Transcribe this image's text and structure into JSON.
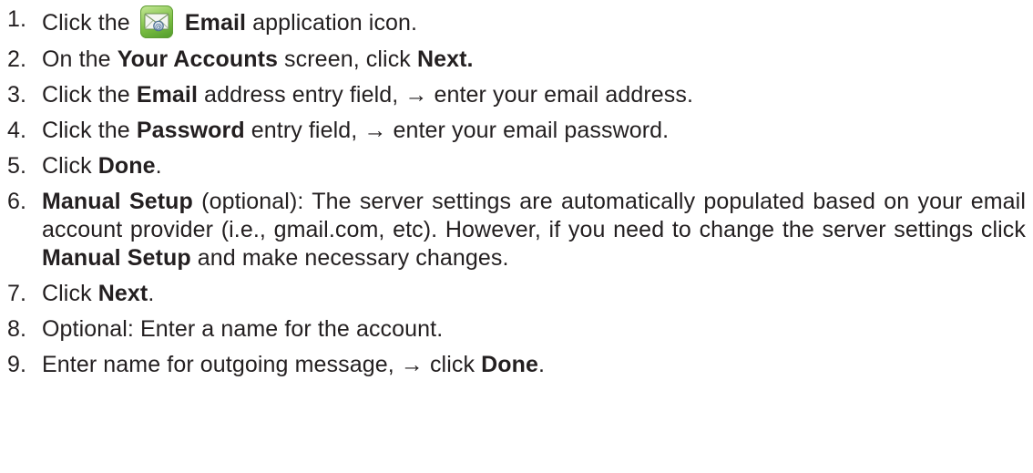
{
  "steps": [
    {
      "num": "1.",
      "parts": [
        {
          "t": "Click the "
        },
        {
          "icon": "email-app-icon"
        },
        {
          "t": " Email",
          "b": true
        },
        {
          "t": " application icon."
        }
      ]
    },
    {
      "num": "2.",
      "parts": [
        {
          "t": "On the "
        },
        {
          "t": "Your Accounts",
          "b": true
        },
        {
          "t": " screen, click "
        },
        {
          "t": "Next.",
          "b": true
        }
      ]
    },
    {
      "num": "3.",
      "parts": [
        {
          "t": "Click the "
        },
        {
          "t": "Email",
          "b": true
        },
        {
          "t": " address entry field, → enter your email address."
        }
      ]
    },
    {
      "num": "4.",
      "parts": [
        {
          "t": "Click the "
        },
        {
          "t": "Password",
          "b": true
        },
        {
          "t": " entry field, → enter your email password."
        }
      ]
    },
    {
      "num": "5.",
      "parts": [
        {
          "t": "Click "
        },
        {
          "t": "Done",
          "b": true
        },
        {
          "t": "."
        }
      ]
    },
    {
      "num": "6.",
      "justify": true,
      "parts": [
        {
          "t": "Manual Setup",
          "b": true
        },
        {
          "t": " (optional): The server settings are automatically populated based on your email account provider (i.e., gmail.com, etc). However, if you need to change the server settings click "
        },
        {
          "t": "Manual Setup",
          "b": true
        },
        {
          "t": " and make necessary changes."
        }
      ]
    },
    {
      "num": "7.",
      "parts": [
        {
          "t": "Click "
        },
        {
          "t": "Next",
          "b": true
        },
        {
          "t": "."
        }
      ]
    },
    {
      "num": "8.",
      "parts": [
        {
          "t": "Optional: Enter a name for the account."
        }
      ]
    },
    {
      "num": "9.",
      "parts": [
        {
          "t": "Enter name for outgoing message, → click "
        },
        {
          "t": "Done",
          "b": true
        },
        {
          "t": "."
        }
      ]
    }
  ],
  "colors": {
    "text": "#231f20",
    "icon_green": "#7cbf43"
  }
}
